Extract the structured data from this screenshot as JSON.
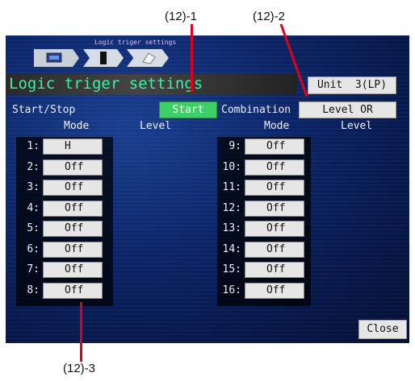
{
  "callouts": {
    "c1": "(12)-1",
    "c2": "(12)-2",
    "c3": "(12)-3"
  },
  "breadcrumb": {
    "title": "Logic triger settings",
    "icons": [
      "monitor-icon",
      "device-icon",
      "gear-icon"
    ]
  },
  "screen": {
    "title": "Logic triger settings",
    "unit_button": "Unit  3(LP)",
    "start_stop_label": "Start/Stop",
    "start_button": "Start",
    "combination_label": "Combination",
    "combination_button": "Level OR",
    "close_button": "Close"
  },
  "headers": {
    "mode": "Mode",
    "level": "Level"
  },
  "left_rows": [
    {
      "num": "1:",
      "mode": "H"
    },
    {
      "num": "2:",
      "mode": "Off"
    },
    {
      "num": "3:",
      "mode": "Off"
    },
    {
      "num": "4:",
      "mode": "Off"
    },
    {
      "num": "5:",
      "mode": "Off"
    },
    {
      "num": "6:",
      "mode": "Off"
    },
    {
      "num": "7:",
      "mode": "Off"
    },
    {
      "num": "8:",
      "mode": "Off"
    }
  ],
  "right_rows": [
    {
      "num": "9:",
      "mode": "Off"
    },
    {
      "num": "10:",
      "mode": "Off"
    },
    {
      "num": "11:",
      "mode": "Off"
    },
    {
      "num": "12:",
      "mode": "Off"
    },
    {
      "num": "13:",
      "mode": "Off"
    },
    {
      "num": "14:",
      "mode": "Off"
    },
    {
      "num": "15:",
      "mode": "Off"
    },
    {
      "num": "16:",
      "mode": "Off"
    }
  ],
  "colors": {
    "title_green": "#3ff0a0",
    "start_green": "#3fcf68",
    "callout_red": "#e0001a"
  }
}
